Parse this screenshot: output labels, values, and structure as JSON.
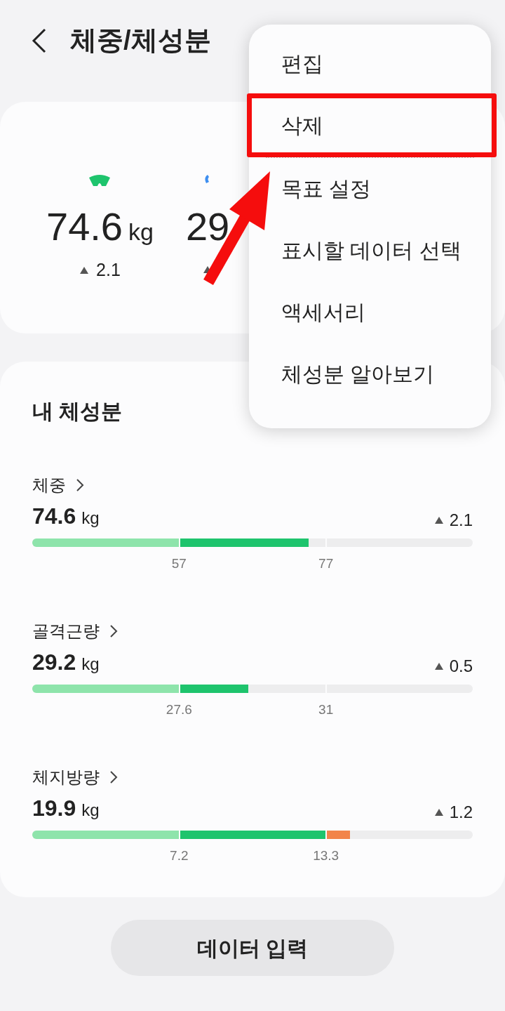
{
  "header": {
    "title": "체중/체성분"
  },
  "summary": [
    {
      "kind": "weight",
      "value": "74.6",
      "unit": "kg",
      "change": "2.1"
    },
    {
      "kind": "muscle",
      "value": "29"
    }
  ],
  "body_composition": {
    "title": "내 체성분",
    "metrics": [
      {
        "name": "체중",
        "value": "74.6",
        "unit": "kg",
        "change": "2.1",
        "level": 0.627,
        "ticks": [
          "57",
          "77"
        ]
      },
      {
        "name": "골격근량",
        "value": "29.2",
        "unit": "kg",
        "change": "0.5",
        "level": 0.49,
        "ticks": [
          "27.6",
          "31"
        ]
      },
      {
        "name": "체지방량",
        "value": "19.9",
        "unit": "kg",
        "change": "1.2",
        "level": 0.721,
        "ticks": [
          "7.2",
          "13.3"
        ]
      }
    ]
  },
  "primary_button": "데이터 입력",
  "menu": {
    "items": [
      {
        "label": "편집",
        "highlighted": false,
        "divider_after": false
      },
      {
        "label": "삭제",
        "highlighted": true,
        "divider_after": true
      },
      {
        "label": "목표 설정",
        "highlighted": false,
        "divider_after": false
      },
      {
        "label": "표시할 데이터 선택",
        "highlighted": false,
        "divider_after": false
      },
      {
        "label": "액세서리",
        "highlighted": false,
        "divider_after": false
      },
      {
        "label": "체성분 알아보기",
        "highlighted": false,
        "divider_after": false
      }
    ]
  }
}
